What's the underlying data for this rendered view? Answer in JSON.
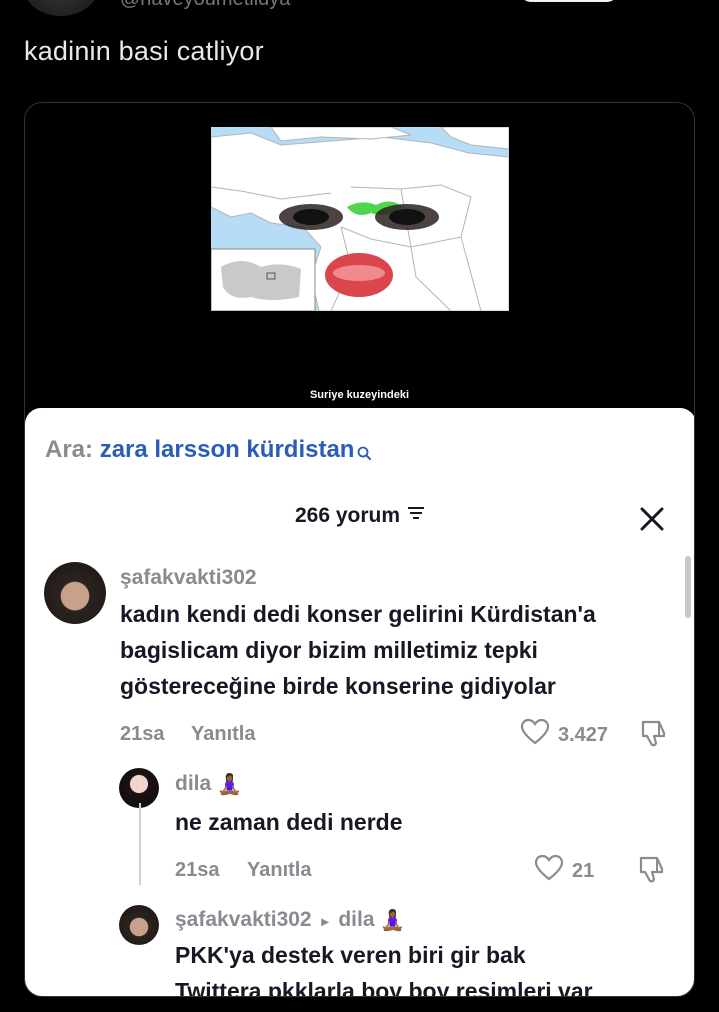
{
  "tweet": {
    "handle": "@haveyoumetlidya",
    "text": "kadinin basi catliyor"
  },
  "video": {
    "caption_line1": "Suriye kuzeyindeki",
    "caption_line2": "..."
  },
  "comments_sheet": {
    "search_prefix": "Ara:",
    "search_query": "zara larsson kürdistan",
    "count_label": "266 yorum",
    "comments": [
      {
        "username": "şafakvakti302",
        "text_lines": [
          "kadın kendi dedi konser gelirini Kürdistan'a",
          "bagislicam diyor bizim milletimiz tepki",
          "göstereceğine birde konserine gidiyolar"
        ],
        "time": "21sa",
        "reply_label": "Yanıtla",
        "likes": "3.427"
      },
      {
        "username": "dila",
        "username_emoji": "🧘🏾‍♀️",
        "text": "ne zaman dedi nerde",
        "time": "21sa",
        "reply_label": "Yanıtla",
        "likes": "21"
      },
      {
        "username": "şafakvakti302",
        "reply_to_separator": "▸",
        "reply_to": "dila",
        "reply_to_emoji": "🧘🏾‍♀️",
        "text_lines": [
          "PKK'ya destek veren biri gir bak",
          "Twittera pkklarla boy boy resimleri var"
        ]
      }
    ]
  },
  "colors": {
    "background": "#000000",
    "sheet": "#ffffff",
    "search_query": "#2b5db8",
    "muted": "#8a8b91"
  },
  "icons": [
    "search-icon",
    "sort-icon",
    "close-icon",
    "heart-icon",
    "dislike-icon"
  ]
}
